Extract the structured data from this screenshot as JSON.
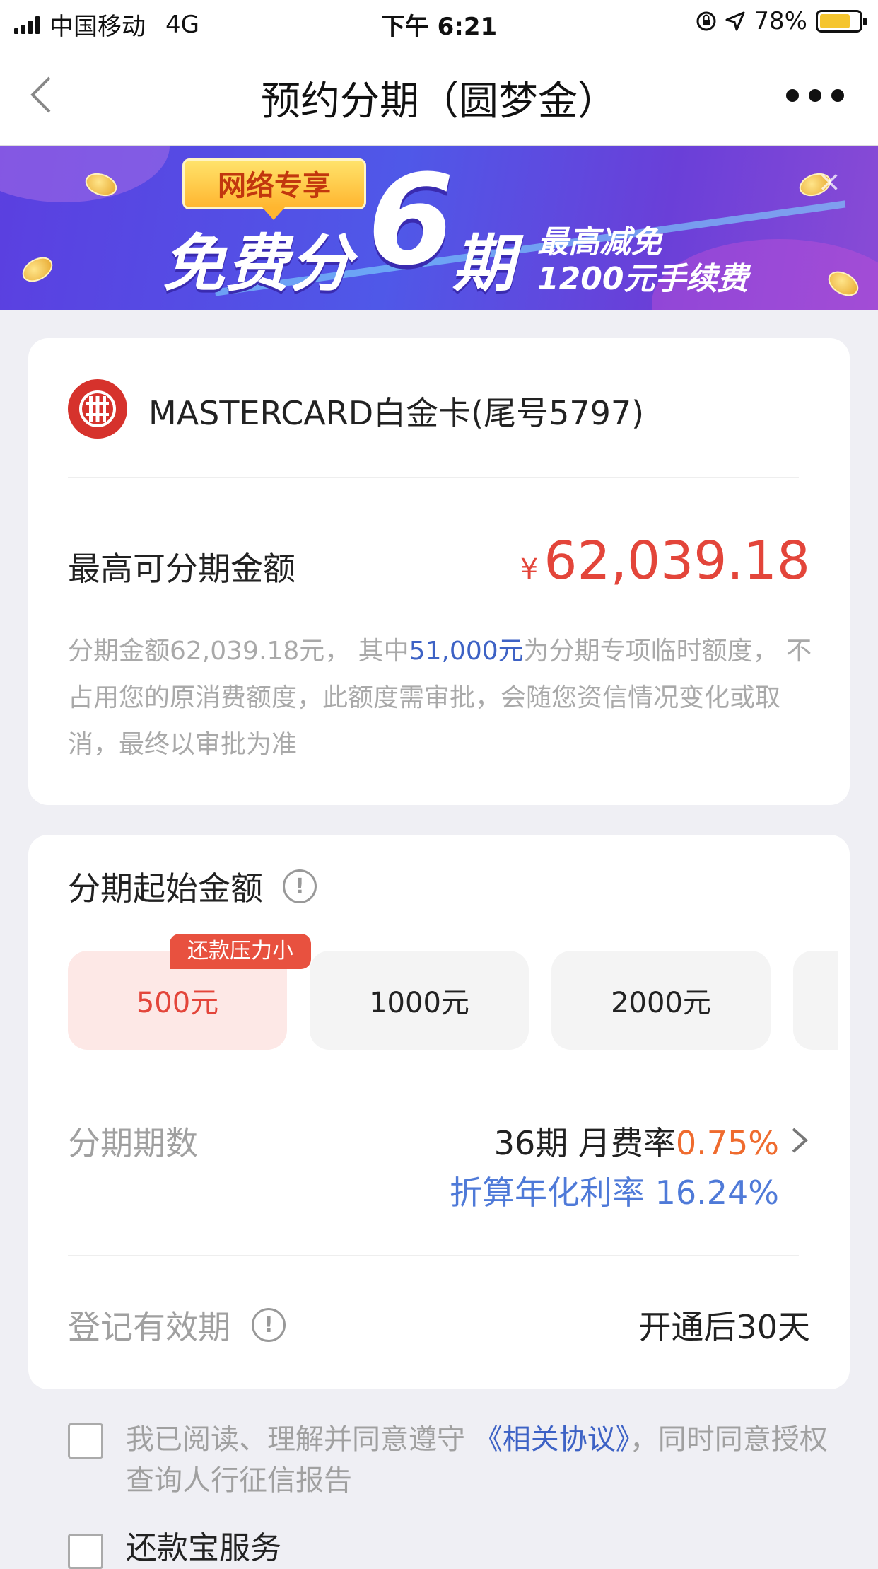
{
  "status_bar": {
    "carrier": "中国移动",
    "network": "4G",
    "time": "下午 6:21",
    "battery": "78%",
    "battery_level": 0.78
  },
  "nav": {
    "title": "预约分期（圆梦金）"
  },
  "banner": {
    "tag": "网络专享",
    "main": "免费分",
    "big_number": "6",
    "main_suffix": "期",
    "sub1": "最高减免",
    "sub2": "1200元手续费",
    "close": "×"
  },
  "card": {
    "name": "MASTERCARD白金卡(尾号5797)",
    "max_label": "最高可分期金额",
    "currency": "¥",
    "max_amount": "62,039.18",
    "note_part1": "分期金额62,039.18元， 其中",
    "note_highlight": "51,000元",
    "note_part2": "为分期专项临时额度， 不占用您的原消费额度，此额度需审批，会随您资信情况变化或取消，最终以审批为准"
  },
  "installment": {
    "start_title": "分期起始金额",
    "info_glyph": "!",
    "badge": "还款压力小",
    "amounts": [
      "500元",
      "1000元",
      "2000元"
    ],
    "selected_index": 0,
    "periods_label": "分期期数",
    "periods_value": "36期 月费率",
    "monthly_rate": "0.75%",
    "annual_rate": "折算年化利率 16.24%",
    "valid_label": "登记有效期",
    "valid_value": "开通后30天"
  },
  "agreements": {
    "agree_text1": "我已阅读、理解并同意遵守 ",
    "agree_link": "《相关协议》",
    "agree_text2": "，同时同意授权查询人行征信报告",
    "service_label": "还款宝服务"
  }
}
